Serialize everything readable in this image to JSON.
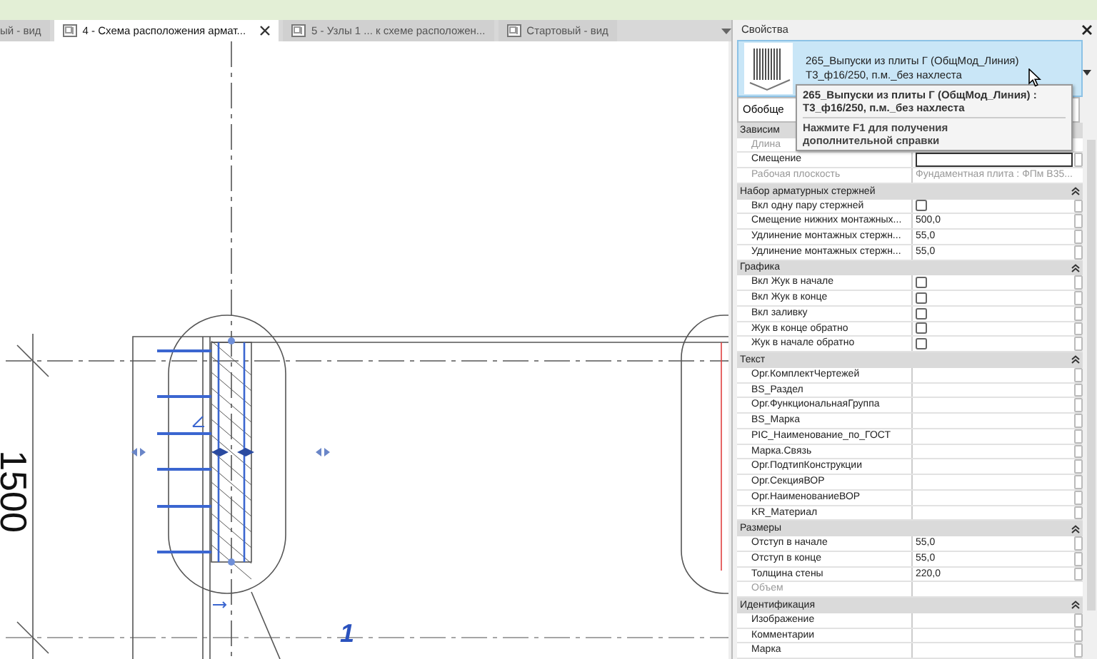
{
  "tabs": [
    {
      "label": "ый - вид",
      "selected": false,
      "icon": false,
      "closable": false
    },
    {
      "label": "4 - Схема расположения армат...",
      "selected": true,
      "icon": true,
      "closable": true
    },
    {
      "label": "5 - Узлы 1 ... к схеме расположен...",
      "selected": false,
      "icon": true,
      "closable": false
    },
    {
      "label": "Стартовый - вид",
      "selected": false,
      "icon": true,
      "closable": false
    }
  ],
  "canvas": {
    "dimension": "1500",
    "marker": "1"
  },
  "properties": {
    "title": "Свойства",
    "type_selector": {
      "line_1": "265_Выпуски из плиты Г (ОбщМод_Линия)",
      "line_2": "Т3_ф16/250, п.м._без нахлеста"
    },
    "tooltip": {
      "title": "265_Выпуски из плиты Г (ОбщМод_Линия) : Т3_ф16/250, п.м._без нахлеста",
      "hint": "Нажмите F1 для получения дополнительной справки"
    },
    "filter": "Обобще",
    "groups": [
      {
        "label": "Зависим",
        "collapse_icon": false,
        "rows": [
          {
            "label": "Длина",
            "kind": "text",
            "disabled": true
          },
          {
            "label": "Смещение",
            "kind": "field",
            "disabled": false
          },
          {
            "label": "Рабочая плоскость",
            "kind": "text",
            "disabled": true,
            "value": "Фундаментная плита : ФПм В35..."
          }
        ]
      },
      {
        "label": "Набор арматурных стержней",
        "collapse_icon": true,
        "rows": [
          {
            "label": "Вкл одну пару стержней",
            "kind": "checkbox",
            "checked": false,
            "disabled": false
          },
          {
            "label": "Смещение нижних монтажных...",
            "kind": "text",
            "value": "500,0",
            "disabled": false
          },
          {
            "label": "Удлинение монтажных стержн...",
            "kind": "text",
            "value": "55,0",
            "disabled": false
          },
          {
            "label": "Удлинение монтажных стержн...",
            "kind": "text",
            "value": "55,0",
            "disabled": false
          }
        ]
      },
      {
        "label": "Графика",
        "collapse_icon": true,
        "rows": [
          {
            "label": "Вкл Жук в начале",
            "kind": "checkbox",
            "checked": false,
            "disabled": false
          },
          {
            "label": "Вкл Жук в конце",
            "kind": "checkbox",
            "checked": false,
            "disabled": false
          },
          {
            "label": "Вкл заливку",
            "kind": "checkbox",
            "checked": false,
            "disabled": false
          },
          {
            "label": "Жук в конце обратно",
            "kind": "checkbox",
            "checked": false,
            "disabled": false
          },
          {
            "label": "Жук в начале обратно",
            "kind": "checkbox",
            "checked": false,
            "disabled": false
          }
        ]
      },
      {
        "label": "Текст",
        "collapse_icon": true,
        "rows": [
          {
            "label": "Орг.КомплектЧертежей",
            "kind": "text",
            "disabled": false
          },
          {
            "label": "BS_Раздел",
            "kind": "text",
            "disabled": false
          },
          {
            "label": "Орг.ФункциональнаяГруппа",
            "kind": "text",
            "disabled": false
          },
          {
            "label": "BS_Марка",
            "kind": "text",
            "disabled": false
          },
          {
            "label": "PIC_Наименование_по_ГОСТ",
            "kind": "text",
            "disabled": false
          },
          {
            "label": "Марка.Связь",
            "kind": "text",
            "disabled": false
          },
          {
            "label": "Орг.ПодтипКонструкции",
            "kind": "text",
            "disabled": false
          },
          {
            "label": "Орг.СекцияВОР",
            "kind": "text",
            "disabled": false
          },
          {
            "label": "Орг.НаименованиеВОР",
            "kind": "text",
            "disabled": false
          },
          {
            "label": "KR_Материал",
            "kind": "text",
            "disabled": false
          }
        ]
      },
      {
        "label": "Размеры",
        "collapse_icon": true,
        "rows": [
          {
            "label": "Отступ в начале",
            "kind": "text",
            "value": "55,0",
            "disabled": false
          },
          {
            "label": "Отступ в конце",
            "kind": "text",
            "value": "55,0",
            "disabled": false
          },
          {
            "label": "Толщина стены",
            "kind": "text",
            "value": "220,0",
            "disabled": false
          },
          {
            "label": "Объем",
            "kind": "text",
            "disabled": true
          }
        ]
      },
      {
        "label": "Идентификация",
        "collapse_icon": true,
        "rows": [
          {
            "label": "Изображение",
            "kind": "text",
            "disabled": false
          },
          {
            "label": "Комментарии",
            "kind": "text",
            "disabled": false
          },
          {
            "label": "Марка",
            "kind": "text",
            "disabled": false
          }
        ]
      }
    ]
  }
}
